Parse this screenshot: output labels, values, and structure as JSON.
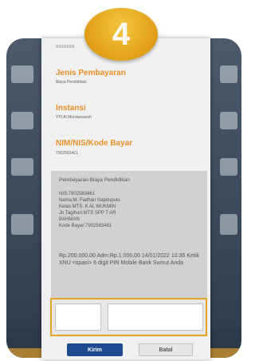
{
  "step_badge": "4",
  "dialog": {
    "top_text": "XXXXXXX",
    "jenis_label": "Jenis Pembayaran",
    "jenis_value": "Biaya Pendidikan",
    "instansi_label": "Instansi",
    "instansi_value": "YPI Al Munawwarah",
    "nim_label": "NIM/NIS/Kode Bayar",
    "nim_value": "7902583461"
  },
  "detail": {
    "heading": "Pembayaran Biaya Pendidikan",
    "lines": [
      "NIS:7902583461",
      "Nama:M. Fadhan Napitupulu",
      "Kelas:MTS. K AL MUKMIN",
      "Jn Tagihan:MTS SPP 7 AR",
      "BAHMAN",
      "Kode Bayar:7902583461"
    ],
    "footer": "Rp.200.000,00 Adm:Rp.1.000,00 14/01/2022 10:35 Ketik XNU <spasi> 6 digit PIN Mobile Bank Sumut Anda"
  },
  "buttons": {
    "send": "Kirim",
    "cancel": "Batal"
  },
  "colors": {
    "accent": "#e8902a",
    "badge": "#e2a21a",
    "send_button": "#1e4a8f"
  }
}
